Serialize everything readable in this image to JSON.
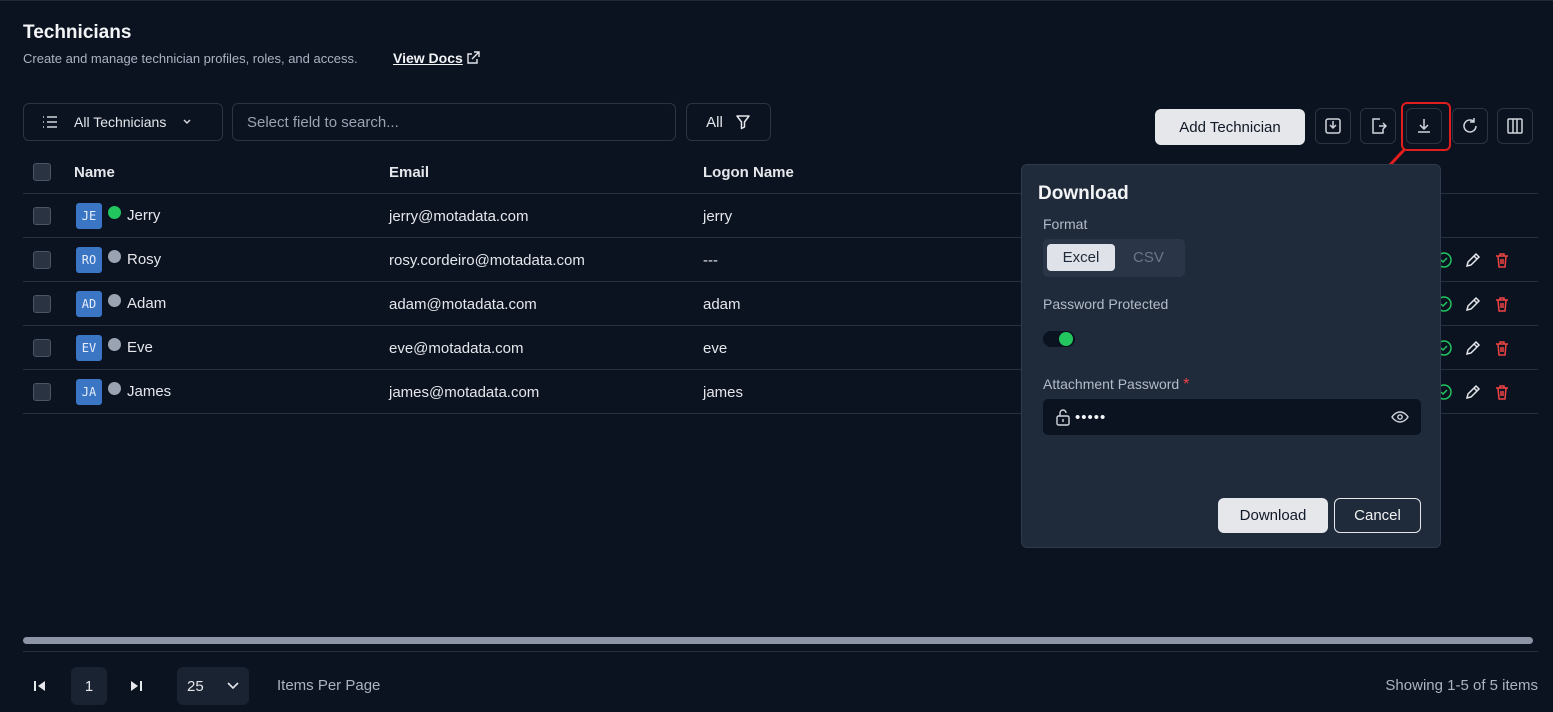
{
  "header": {
    "title": "Technicians",
    "subtitle": "Create and manage technician profiles, roles, and access.",
    "view_docs": "View Docs"
  },
  "toolbar": {
    "view_select": "All Technicians",
    "search_placeholder": "Select field to search...",
    "filter_label": "All",
    "add_button": "Add Technician",
    "icons": [
      "import-icon",
      "export-icon",
      "download-icon",
      "refresh-icon",
      "columns-icon"
    ]
  },
  "table": {
    "columns": [
      "Name",
      "Email",
      "Logon Name"
    ],
    "rows": [
      {
        "initials": "JE",
        "name": "Jerry",
        "status": "online",
        "email": "jerry@motadata.com",
        "logon": "jerry"
      },
      {
        "initials": "RO",
        "name": "Rosy",
        "status": "offline",
        "email": "rosy.cordeiro@motadata.com",
        "logon": "---"
      },
      {
        "initials": "AD",
        "name": "Adam",
        "status": "offline",
        "email": "adam@motadata.com",
        "logon": "adam"
      },
      {
        "initials": "EV",
        "name": "Eve",
        "status": "offline",
        "email": "eve@motadata.com",
        "logon": "eve"
      },
      {
        "initials": "JA",
        "name": "James",
        "status": "offline",
        "email": "james@motadata.com",
        "logon": "james"
      }
    ]
  },
  "pagination": {
    "current_page": "1",
    "per_page": "25",
    "per_page_label": "Items Per Page",
    "showing": "Showing 1-5 of 5 items"
  },
  "download_popup": {
    "title": "Download",
    "format_label": "Format",
    "format_options": [
      "Excel",
      "CSV"
    ],
    "format_selected": "Excel",
    "password_protected_label": "Password Protected",
    "password_protected": true,
    "attachment_password_label": "Attachment Password",
    "required_mark": "*",
    "password_value": "•••••",
    "download_button": "Download",
    "cancel_button": "Cancel"
  },
  "colors": {
    "background": "#0b1220",
    "popup": "#1f2a3a",
    "accent_green": "#22c55e",
    "delete_red": "#ef4444",
    "highlight_red": "#e11d1d",
    "avatar_blue": "#3b76c4"
  }
}
